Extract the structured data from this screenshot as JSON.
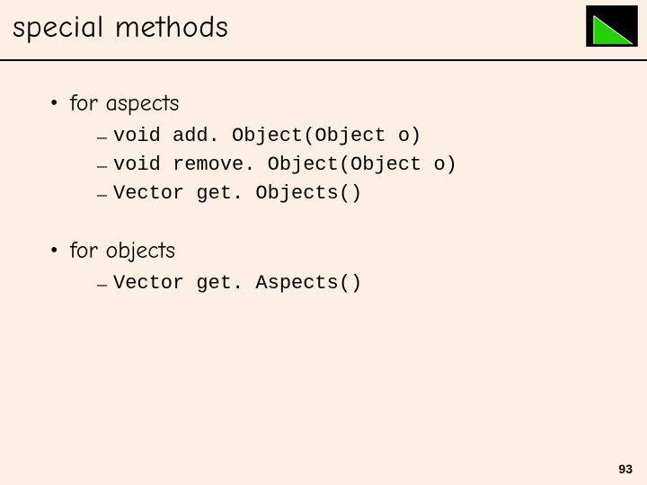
{
  "title": "special methods",
  "page_number": "93",
  "sections": [
    {
      "heading": "for aspects",
      "items": [
        "void add. Object(Object o)",
        "void remove. Object(Object o)",
        "Vector get. Objects()"
      ]
    },
    {
      "heading": "for objects",
      "items": [
        "Vector get. Aspects()"
      ]
    }
  ]
}
